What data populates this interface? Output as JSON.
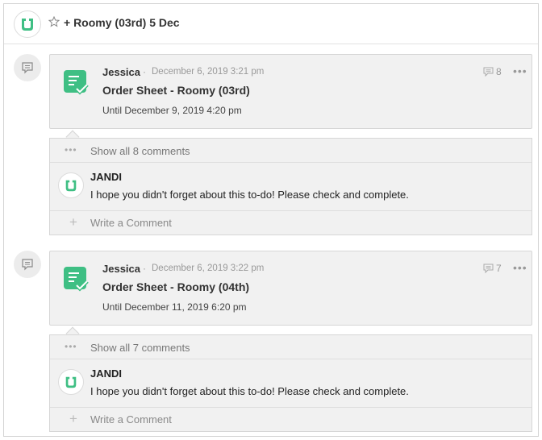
{
  "header": {
    "title": "+ Roomy (03rd) 5 Dec",
    "logo_icon": "jandi-logo-icon",
    "star_icon": "star-outline-icon"
  },
  "colors": {
    "brand_green": "#3fbf84",
    "card_bg": "#f1f1f1",
    "muted_text": "#999999"
  },
  "posts": [
    {
      "author": "Jessica",
      "separator": "·",
      "timestamp": "December 6, 2019 3:21 pm",
      "title": "Order Sheet - Roomy (03rd)",
      "due": "Until December 9, 2019 4:20 pm",
      "comment_count": "8",
      "more": "•••",
      "show_all": "Show all 8 comments",
      "comment": {
        "name": "JANDI",
        "text": "I hope you didn't forget about this to-do! Please check and complete."
      },
      "write_placeholder": "Write a Comment"
    },
    {
      "author": "Jessica",
      "separator": "·",
      "timestamp": "December 6, 2019 3:22 pm",
      "title": "Order Sheet - Roomy (04th)",
      "due": "Until December 11, 2019 6:20 pm",
      "comment_count": "7",
      "more": "•••",
      "show_all": "Show all 7 comments",
      "comment": {
        "name": "JANDI",
        "text": "I hope you didn't forget about this to-do! Please check and complete."
      },
      "write_placeholder": "Write a Comment"
    }
  ]
}
